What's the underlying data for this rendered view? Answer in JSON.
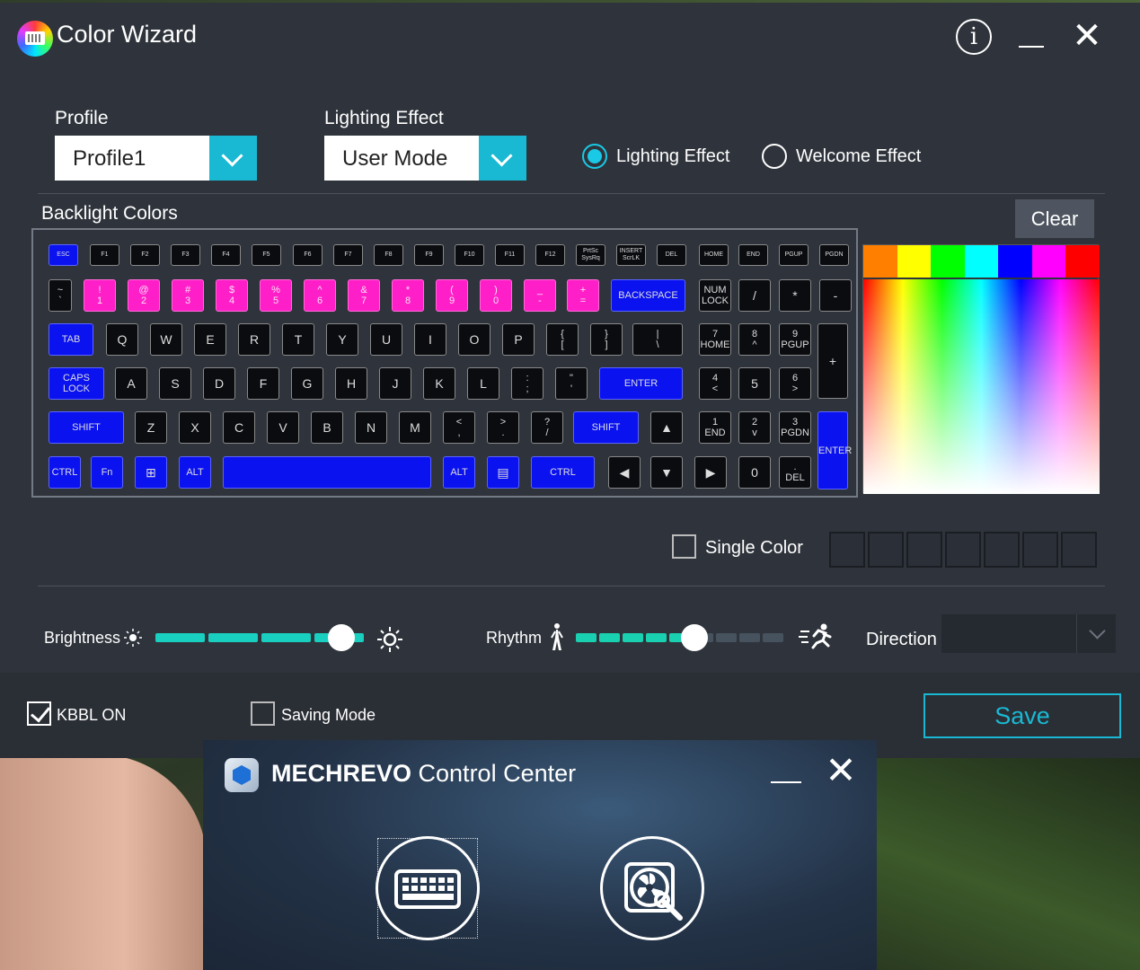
{
  "app": {
    "title": "Color Wizard"
  },
  "titlebar": {
    "info_icon": "i",
    "close_icon": "✕"
  },
  "profile": {
    "label": "Profile",
    "value": "Profile1"
  },
  "lighting_select": {
    "label": "Lighting Effect",
    "value": "User Mode"
  },
  "effect_radios": [
    {
      "label": "Lighting Effect",
      "selected": true
    },
    {
      "label": "Welcome Effect",
      "selected": false
    }
  ],
  "backlight": {
    "heading": "Backlight Colors",
    "clear_label": "Clear"
  },
  "palette": {
    "swatches": [
      "#ff8000",
      "#ffff00",
      "#00ff00",
      "#00ffff",
      "#0000ff",
      "#ff00ff",
      "#ff0000"
    ]
  },
  "key_colors": {
    "blue": "#0a12f0",
    "pink": "#ff1fc8",
    "none": "#0b0c10"
  },
  "keys": [
    {
      "t": "ESC",
      "c": "blue"
    },
    {
      "t": "F1",
      "c": "none"
    },
    {
      "t": "F2",
      "c": "none"
    },
    {
      "t": "F3",
      "c": "none"
    },
    {
      "t": "F4",
      "c": "none"
    },
    {
      "t": "F5",
      "c": "none"
    },
    {
      "t": "F6",
      "c": "none"
    },
    {
      "t": "F7",
      "c": "none"
    },
    {
      "t": "F8",
      "c": "none"
    },
    {
      "t": "F9",
      "c": "none"
    },
    {
      "t": "F10",
      "c": "none"
    },
    {
      "t": "F11",
      "c": "none"
    },
    {
      "t": "F12",
      "c": "none"
    },
    {
      "t": "PrtSc\nSysRq",
      "c": "none"
    },
    {
      "t": "INSERT\nScrLK",
      "c": "none"
    },
    {
      "t": "DEL",
      "c": "none"
    },
    {
      "t": "HOME",
      "c": "none"
    },
    {
      "t": "END",
      "c": "none"
    },
    {
      "t": "PGUP",
      "c": "none"
    },
    {
      "t": "PGDN",
      "c": "none"
    },
    {
      "t": "~\n`",
      "c": "none"
    },
    {
      "t": "!\n1",
      "c": "pink"
    },
    {
      "t": "@\n2",
      "c": "pink"
    },
    {
      "t": "#\n3",
      "c": "pink"
    },
    {
      "t": "$\n4",
      "c": "pink"
    },
    {
      "t": "%\n5",
      "c": "pink"
    },
    {
      "t": "^\n6",
      "c": "pink"
    },
    {
      "t": "&\n7",
      "c": "pink"
    },
    {
      "t": "*\n8",
      "c": "pink"
    },
    {
      "t": "(\n9",
      "c": "pink"
    },
    {
      "t": ")\n0",
      "c": "pink"
    },
    {
      "t": "_\n-",
      "c": "pink"
    },
    {
      "t": "+\n=",
      "c": "pink"
    },
    {
      "t": "BACKSPACE",
      "c": "blue"
    },
    {
      "t": "NUM\nLOCK",
      "c": "none"
    },
    {
      "t": "/",
      "c": "none"
    },
    {
      "t": "*",
      "c": "none"
    },
    {
      "t": "-",
      "c": "none"
    },
    {
      "t": "TAB",
      "c": "blue"
    },
    {
      "t": "Q",
      "c": "none"
    },
    {
      "t": "W",
      "c": "none"
    },
    {
      "t": "E",
      "c": "none"
    },
    {
      "t": "R",
      "c": "none"
    },
    {
      "t": "T",
      "c": "none"
    },
    {
      "t": "Y",
      "c": "none"
    },
    {
      "t": "U",
      "c": "none"
    },
    {
      "t": "I",
      "c": "none"
    },
    {
      "t": "O",
      "c": "none"
    },
    {
      "t": "P",
      "c": "none"
    },
    {
      "t": "{\n[",
      "c": "none"
    },
    {
      "t": "}\n]",
      "c": "none"
    },
    {
      "t": "|\n\\",
      "c": "none"
    },
    {
      "t": "7\nHOME",
      "c": "none"
    },
    {
      "t": "8\n^",
      "c": "none"
    },
    {
      "t": "9\nPGUP",
      "c": "none"
    },
    {
      "t": "+",
      "c": "none"
    },
    {
      "t": "CAPS\nLOCK",
      "c": "blue"
    },
    {
      "t": "A",
      "c": "none"
    },
    {
      "t": "S",
      "c": "none"
    },
    {
      "t": "D",
      "c": "none"
    },
    {
      "t": "F",
      "c": "none"
    },
    {
      "t": "G",
      "c": "none"
    },
    {
      "t": "H",
      "c": "none"
    },
    {
      "t": "J",
      "c": "none"
    },
    {
      "t": "K",
      "c": "none"
    },
    {
      "t": "L",
      "c": "none"
    },
    {
      "t": ":\n;",
      "c": "none"
    },
    {
      "t": "\"\n'",
      "c": "none"
    },
    {
      "t": "ENTER",
      "c": "blue"
    },
    {
      "t": "4\n<",
      "c": "none"
    },
    {
      "t": "5",
      "c": "none"
    },
    {
      "t": "6\n>",
      "c": "none"
    },
    {
      "t": "SHIFT",
      "c": "blue"
    },
    {
      "t": "Z",
      "c": "none"
    },
    {
      "t": "X",
      "c": "none"
    },
    {
      "t": "C",
      "c": "none"
    },
    {
      "t": "V",
      "c": "none"
    },
    {
      "t": "B",
      "c": "none"
    },
    {
      "t": "N",
      "c": "none"
    },
    {
      "t": "M",
      "c": "none"
    },
    {
      "t": "<\n,",
      "c": "none"
    },
    {
      "t": ">\n.",
      "c": "none"
    },
    {
      "t": "?\n/",
      "c": "none"
    },
    {
      "t": "SHIFT",
      "c": "blue"
    },
    {
      "t": "▲",
      "c": "none"
    },
    {
      "t": "1\nEND",
      "c": "none"
    },
    {
      "t": "2\nv",
      "c": "none"
    },
    {
      "t": "3\nPGDN",
      "c": "none"
    },
    {
      "t": "ENTER",
      "c": "blue"
    },
    {
      "t": "CTRL",
      "c": "blue"
    },
    {
      "t": "Fn",
      "c": "blue"
    },
    {
      "t": "⊞",
      "c": "blue"
    },
    {
      "t": "ALT",
      "c": "blue"
    },
    {
      "t": "",
      "c": "blue"
    },
    {
      "t": "ALT",
      "c": "blue"
    },
    {
      "t": "▤",
      "c": "blue"
    },
    {
      "t": "CTRL",
      "c": "blue"
    },
    {
      "t": "◀",
      "c": "none"
    },
    {
      "t": "▼",
      "c": "none"
    },
    {
      "t": "▶",
      "c": "none"
    },
    {
      "t": "0",
      "c": "none"
    },
    {
      "t": ".\nDEL",
      "c": "none"
    }
  ],
  "single_color": {
    "label": "Single Color",
    "checked": false
  },
  "brightness": {
    "label": "Brightness",
    "level_fraction": 0.88
  },
  "rhythm": {
    "label": "Rhythm",
    "level_fraction": 0.56
  },
  "direction": {
    "label": "Direction",
    "value": ""
  },
  "kbbl": {
    "label": "KBBL ON",
    "checked": true
  },
  "saving_mode": {
    "label": "Saving Mode",
    "checked": false
  },
  "save": {
    "label": "Save"
  },
  "control_center": {
    "brand": "MECHREVO",
    "title": "Control Center",
    "close_icon": "✕"
  }
}
